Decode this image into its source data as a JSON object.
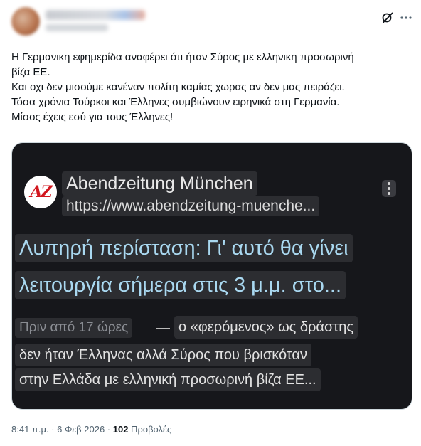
{
  "post": {
    "text_lines": [
      "Η Γερμανικη εφημερίδα αναφέρει ότι ήταν Σύρος με ελληνικη προσωρινή",
      "βίζα ΕΕ.",
      "Και οχι δεν μισούμε κανέναν πολίτη καμίας χωρας αν δεν μας πειράζει.",
      "Τόσα χρόνια Τούρκοι και Έλληνες συμβιώνουν ειρηνικά  στη Γερμανία.",
      "Μίσος έχεις εσύ για τους Έλληνες!"
    ],
    "icons": {
      "grok": "grok-icon",
      "more": "more-options-icon"
    }
  },
  "media": {
    "source_logo": "AZ",
    "source_name": "Abendzeitung München",
    "source_url": "https://www.abendzeitung-muenche...",
    "headline_line1": "Λυπηρή περίσταση: Γι' αυτό θα γίνει",
    "headline_line2": "λειτουργία σήμερα στις 3 μ.μ. στο...",
    "time_ago": "Πριν από 17 ώρες",
    "separator": "—",
    "snippet_line1": "ο «φερόμενος» ως δράστης",
    "snippet_line2": "δεν ήταν Έλληνας αλλά Σύρος που βρισκόταν",
    "snippet_line3": "στην Ελλάδα με ελληνική προσωρινή βίζα ΕΕ...",
    "colors": {
      "background": "#16171b",
      "headline": "#a9d8f0",
      "logo_red": "#d2161e"
    }
  },
  "footer": {
    "timestamp": "8:41 π.μ. · 6 Φεβ 2026 · ",
    "views_count": "102",
    "views_label": " Προβολές"
  }
}
